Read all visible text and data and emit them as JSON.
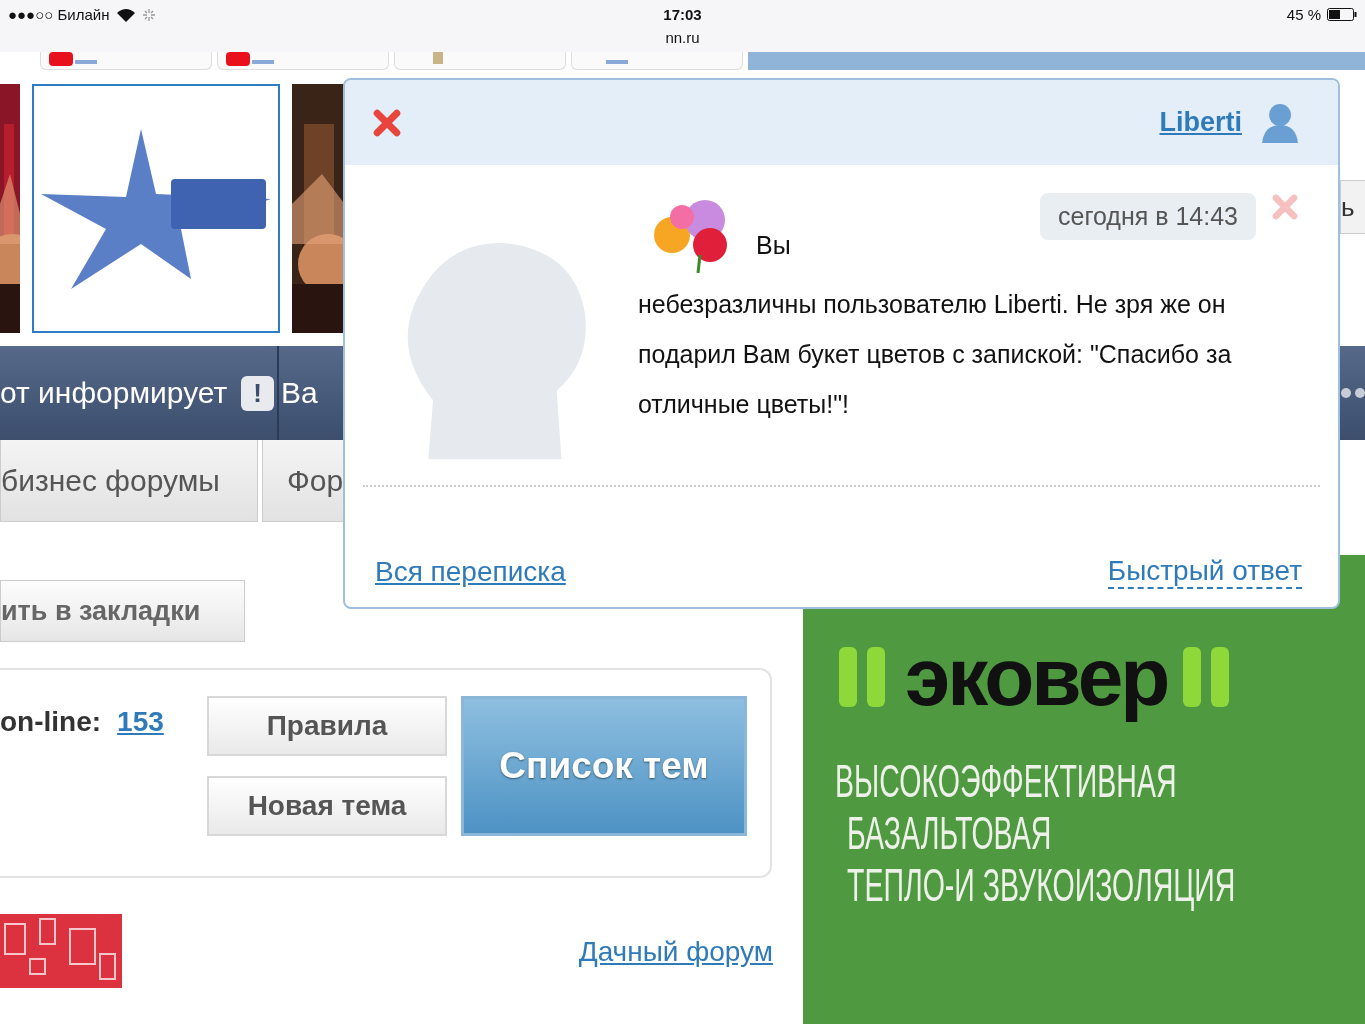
{
  "status_bar": {
    "carrier": "●●●○○ Билайн",
    "time": "17:03",
    "url": "nn.ru",
    "battery": "45 %"
  },
  "browser_tabs": [
    {
      "kind": "red"
    },
    {
      "kind": "red"
    },
    {
      "kind": "picture"
    },
    {
      "kind": "plain"
    }
  ],
  "banners": [
    {
      "kind": "picture"
    },
    {
      "kind": "logo"
    },
    {
      "kind": "picture"
    }
  ],
  "side_button": "ь",
  "info_bar": {
    "text": "от информирует",
    "badge": "!",
    "next": "Ва"
  },
  "forum_tabs": [
    {
      "label": "бизнес форумы"
    },
    {
      "label": "Фор"
    }
  ],
  "bookmark_button": "ить в закладки",
  "online": {
    "label": "on-line:",
    "count": "153"
  },
  "buttons": [
    "Правила",
    "Новая тема"
  ],
  "primary_button": "Список тем",
  "dacha_link": "Дачный форум",
  "ad": {
    "brand": "эковер",
    "lines": [
      "ВЫСОКОЭФФЕКТИВНАЯ",
      "БАЗАЛЬТОВАЯ",
      "ТЕПЛО-И ЗВУКОИЗОЛЯЦИЯ"
    ]
  },
  "popup": {
    "user": "Liberti",
    "sender": "Вы",
    "time": "сегодня в 14:43",
    "message": "небезразличны пользователю Liberti. Не зря же он подарил Вам букет цветов с запиской: \"Спасибо за отличные цветы!\"!",
    "all_link": "Вся переписка",
    "reply_link": "Быстрый ответ"
  }
}
